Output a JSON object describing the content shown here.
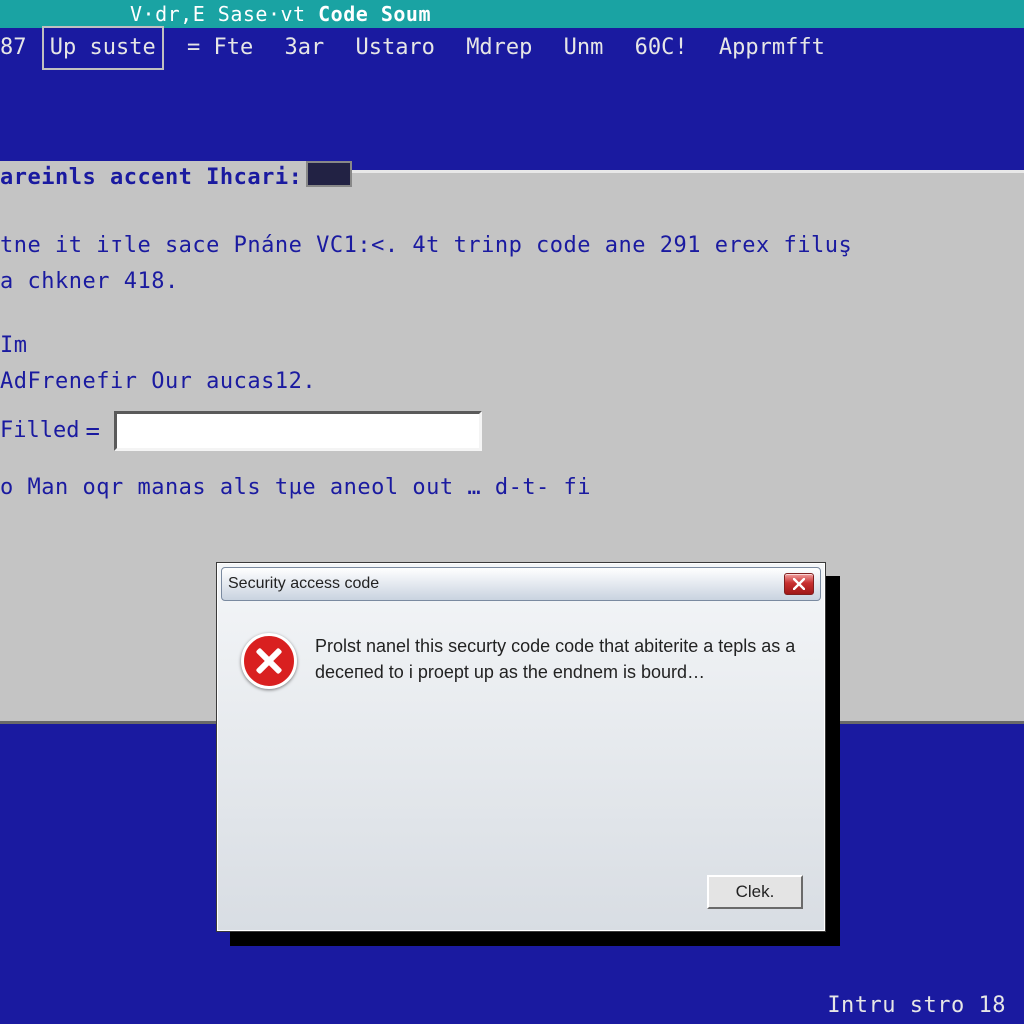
{
  "titlebar": {
    "text_prefix": "V·dr,E Sase·vt ",
    "text_bold": "Code Soum"
  },
  "menubar": {
    "prefix": "87",
    "items": [
      "Up suste",
      "= Fte",
      "3ar",
      "Ustaro",
      "Mdrep",
      "Unm",
      "60C!",
      "Apprmfft"
    ]
  },
  "panel": {
    "title": "areinls accent Ihcari:",
    "line1": "tne it iтle sace Pnáne VC1:<. 4t trinp code ane 291 erex filuş",
    "line2": "a chkner 418.",
    "line3": "Im",
    "line4": "AdFrenefir Our aucas12.",
    "input_label": "Filled",
    "input_value": "",
    "line5": "o Man oqr manas  als  tµe  aneol  out  … d-t-  fi"
  },
  "dialog": {
    "title": "Security access code",
    "message": "Prolst nanel this securty code code that abiterite a tepls as a deceпed to i proept up as the endnem is bourd…",
    "button": "Clek.",
    "icon": "error-icon"
  },
  "statusbar": {
    "text": "Intru stro 18"
  }
}
